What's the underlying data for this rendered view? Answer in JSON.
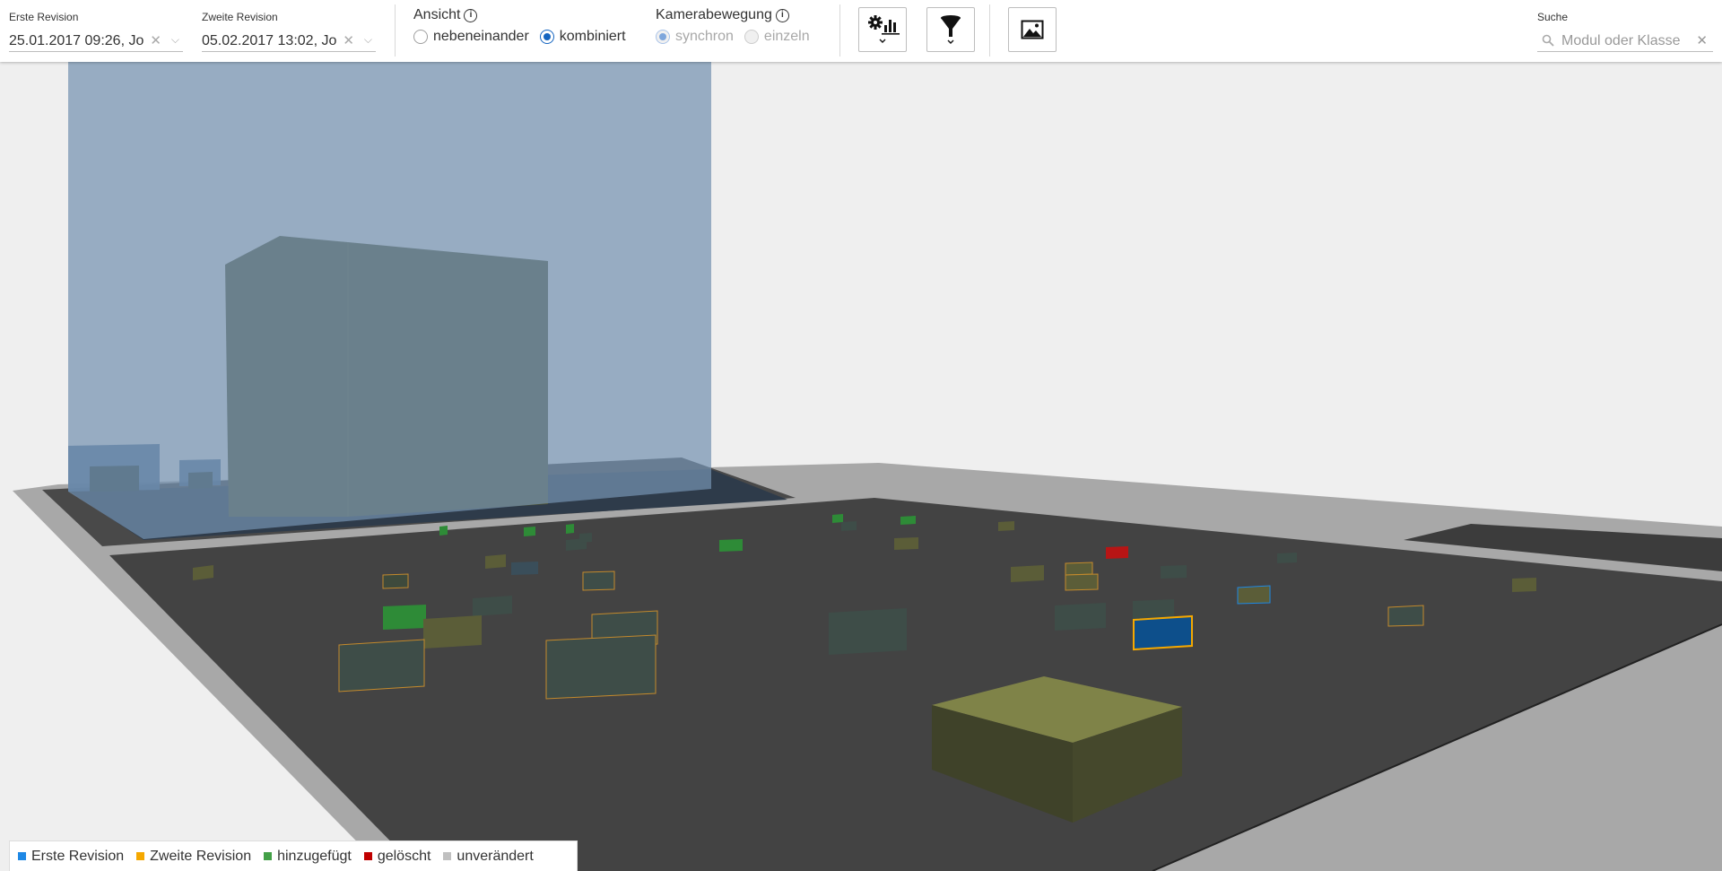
{
  "first_revision": {
    "label": "Erste Revision",
    "value": "25.01.2017 09:26, Jo"
  },
  "second_revision": {
    "label": "Zweite Revision",
    "value": "05.02.2017 13:02, Jo"
  },
  "view": {
    "title": "Ansicht",
    "options": [
      "nebeneinander",
      "kombiniert"
    ],
    "selected": "kombiniert"
  },
  "camera": {
    "title": "Kamerabewegung",
    "options": [
      "synchron",
      "einzeln"
    ],
    "selected": "synchron",
    "disabled": true
  },
  "toolbar_buttons": {
    "metrics": "gear-chart-icon",
    "filter": "funnel-icon",
    "screenshot": "image-icon"
  },
  "search": {
    "label": "Suche",
    "placeholder": "Modul oder Klasse"
  },
  "legend": [
    {
      "label": "Erste Revision",
      "color": "#1e88e5"
    },
    {
      "label": "Zweite Revision",
      "color": "#f5a800"
    },
    {
      "label": "hinzugefügt",
      "color": "#43a047"
    },
    {
      "label": "gelöscht",
      "color": "#c00000"
    },
    {
      "label": "unverändert",
      "color": "#c0c0c0"
    }
  ]
}
